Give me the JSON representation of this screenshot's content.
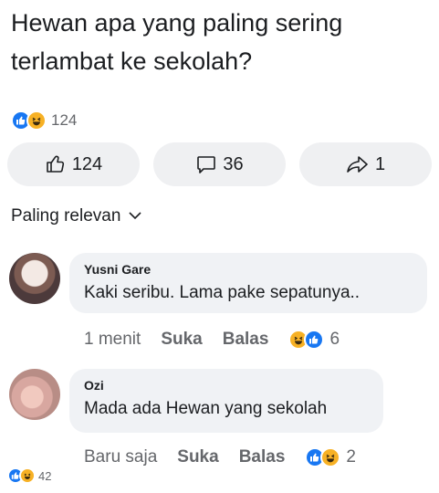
{
  "post": {
    "text": "Hewan apa yang paling sering terlambat ke sekolah?",
    "reaction_count": "124"
  },
  "actions": {
    "like_count": "124",
    "comment_count": "36",
    "share_count": "1"
  },
  "sort": {
    "label": "Paling relevan"
  },
  "comments": [
    {
      "author": "Yusni Gare",
      "text": "Kaki seribu. Lama pake sepatunya..",
      "time": "1 menit",
      "like_label": "Suka",
      "reply_label": "Balas",
      "reaction_count": "6"
    },
    {
      "author": "Ozi",
      "text": "Mada ada Hewan yang sekolah",
      "time": "Baru saja",
      "like_label": "Suka",
      "reply_label": "Balas",
      "reaction_count": "2"
    }
  ],
  "overlay": {
    "reaction_count": "42"
  },
  "colors": {
    "like_blue": "#1877f2",
    "haha_yellow": "#f7b125",
    "bubble_gray": "#f0f2f5",
    "meta_gray": "#65676b"
  },
  "icons": [
    "like-reaction-icon",
    "haha-reaction-icon",
    "thumbs-up-icon",
    "comment-icon",
    "share-icon",
    "chevron-down-icon"
  ]
}
